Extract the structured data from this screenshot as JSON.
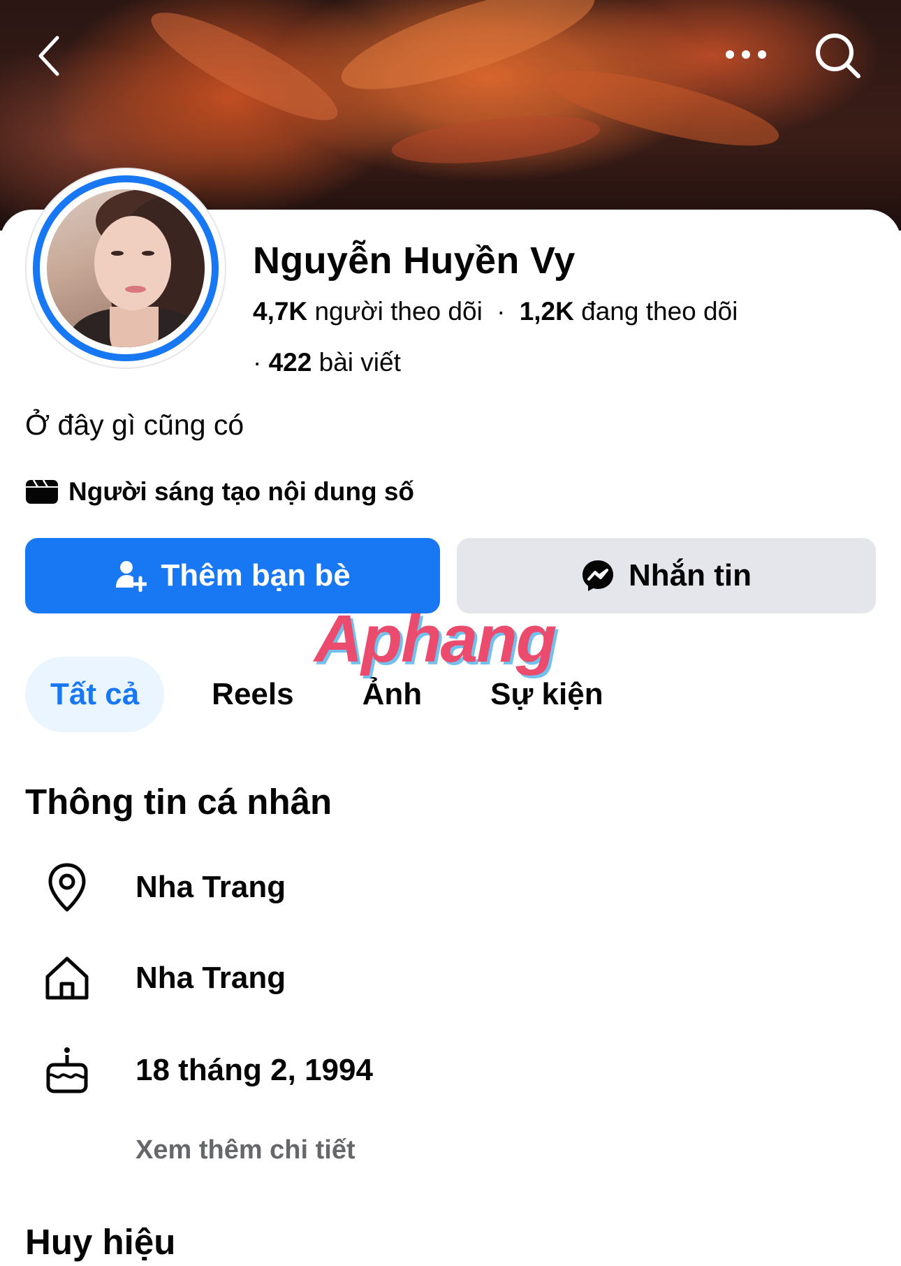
{
  "cover": {
    "back_icon": "chevron-left-icon",
    "more_icon": "ellipsis-icon",
    "search_icon": "search-icon"
  },
  "profile": {
    "name": "Nguyễn Huyền Vy",
    "followers_count": "4,7K",
    "followers_label": "người theo dõi",
    "following_count": "1,2K",
    "following_label": "đang theo dõi",
    "posts_count": "422",
    "posts_label": "bài viết",
    "bio": "Ở đây gì cũng có",
    "category": "Người sáng tạo nội dung số",
    "category_icon": "clapperboard-icon"
  },
  "actions": {
    "add_friend_label": "Thêm bạn bè",
    "add_friend_icon": "add-user-icon",
    "message_label": "Nhắn tin",
    "message_icon": "messenger-icon"
  },
  "watermark": "Aphang",
  "tabs": [
    {
      "label": "Tất cả",
      "active": true
    },
    {
      "label": "Reels",
      "active": false
    },
    {
      "label": "Ảnh",
      "active": false
    },
    {
      "label": "Sự kiện",
      "active": false
    }
  ],
  "personal_info": {
    "title": "Thông tin cá nhân",
    "items": [
      {
        "icon": "location-pin-icon",
        "text": "Nha Trang"
      },
      {
        "icon": "home-icon",
        "text": "Nha Trang"
      },
      {
        "icon": "birthday-cake-icon",
        "text": "18 tháng 2, 1994"
      }
    ],
    "see_more_label": "Xem thêm chi tiết"
  },
  "badges": {
    "title": "Huy hiệu"
  },
  "colors": {
    "accent": "#1877f2",
    "secondary_button": "#e4e6eb",
    "active_tab_bg": "#ebf5ff",
    "muted_text": "#65676b"
  }
}
